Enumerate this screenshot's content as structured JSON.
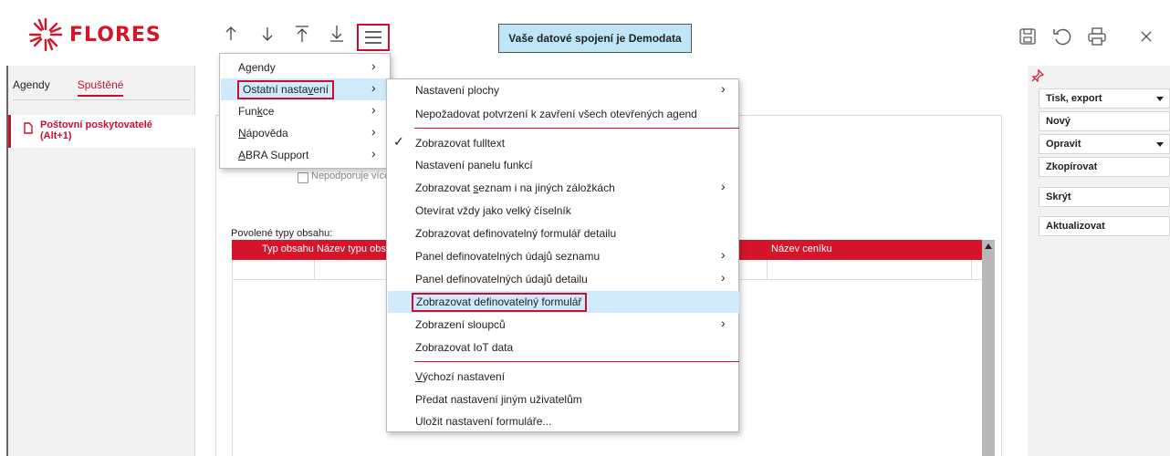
{
  "brand": {
    "name": "FLORES",
    "color": "#d4152a"
  },
  "toolbar": {
    "nav_icons": [
      "arrow-up-icon",
      "arrow-down-icon",
      "arrow-first-icon",
      "arrow-last-icon"
    ],
    "menu_icon": "hamburger-menu-icon",
    "connection_text": "Vaše datové spojení je Demodata",
    "right_icons": [
      "save-icon",
      "refresh-icon",
      "print-icon",
      "close-icon"
    ]
  },
  "sidebar": {
    "tabs": [
      {
        "label": "Agendy",
        "active": false
      },
      {
        "label": "Spuštěné",
        "active": true
      }
    ],
    "running_item": {
      "label_line1": "Poštovní poskytovatelé",
      "label_line2": "(Alt+1)"
    }
  },
  "main": {
    "checkbox_label": "Nepodporuje více",
    "types_label": "Povolené typy obsahu:",
    "grid_columns": [
      "Typ obsahu",
      "Název typu obs",
      "Název ceníku"
    ]
  },
  "right_panel": {
    "buttons": [
      {
        "label": "Tisk, export",
        "dropdown": true
      },
      {
        "label": "Nový",
        "dropdown": false
      },
      {
        "label": "Opravit",
        "dropdown": true
      },
      {
        "label": "Zkopírovat",
        "dropdown": false
      },
      {
        "label": "Skrýt",
        "dropdown": false
      },
      {
        "label": "Aktualizovat",
        "dropdown": false
      }
    ]
  },
  "menu_main": {
    "items": [
      {
        "pre": "A",
        "ul": "g",
        "post": "endy",
        "submenu": true
      },
      {
        "pre": "Ostatní nasta",
        "ul": "v",
        "post": "ení",
        "submenu": true,
        "highlighted": true
      },
      {
        "pre": "Fun",
        "ul": "k",
        "post": "ce",
        "submenu": true
      },
      {
        "pre": "",
        "ul": "N",
        "post": "ápověda",
        "submenu": true
      },
      {
        "pre": "",
        "ul": "A",
        "post": "BRA Support",
        "submenu": true
      }
    ]
  },
  "menu_settings": {
    "items": [
      {
        "pre": "Nastavení plochy",
        "ul": "",
        "post": "",
        "submenu": true
      },
      {
        "pre": "Nepožadovat potvrzení k zavření všech otevřených agend",
        "ul": "",
        "post": ""
      },
      {
        "pre": "Zobrazovat fulltext",
        "ul": "",
        "post": "",
        "checked": true
      },
      {
        "pre": "Nastavení panelu funkcí",
        "ul": "",
        "post": ""
      },
      {
        "pre": "Zobrazovat ",
        "ul": "s",
        "post": "eznam i na jiných záložkách",
        "submenu": true
      },
      {
        "pre": "Otevírat vždy jako velký číselník",
        "ul": "",
        "post": ""
      },
      {
        "pre": "Zobrazovat definovatelný formulář detailu",
        "ul": "",
        "post": ""
      },
      {
        "pre": "Panel definovatelných údajů seznamu",
        "ul": "",
        "post": "",
        "submenu": true
      },
      {
        "pre": "Panel definovatelných údajů detailu",
        "ul": "",
        "post": "",
        "submenu": true
      },
      {
        "pre": "Zobrazovat definovatelný formulář",
        "ul": "",
        "post": "",
        "highlighted": true
      },
      {
        "pre": "Zobrazení sloupců",
        "ul": "",
        "post": "",
        "submenu": true
      },
      {
        "pre": "Zobrazovat IoT data",
        "ul": "",
        "post": ""
      },
      {
        "pre": "",
        "ul": "V",
        "post": "ýchozí nastavení"
      },
      {
        "pre": "Předat nastavení jiným uživatelům",
        "ul": "",
        "post": ""
      },
      {
        "pre": "Uložit nastavení formuláře...",
        "ul": "",
        "post": ""
      }
    ]
  }
}
